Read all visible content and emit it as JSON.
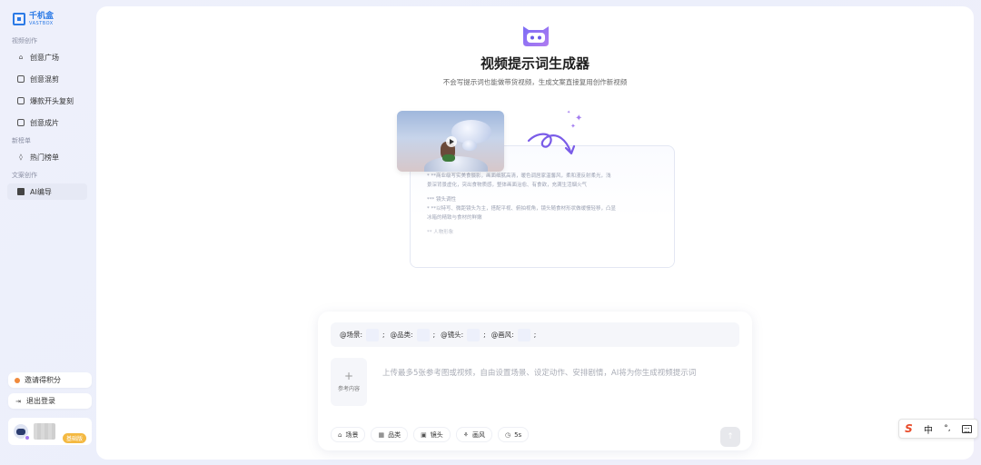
{
  "brand": {
    "name_cn": "千机盒",
    "name_en": "VASTBOX",
    "color": "#2b7ae6"
  },
  "sidebar": {
    "sections": [
      {
        "title": "视频创作",
        "items": [
          {
            "label": "创意广场",
            "icon": "home-icon"
          },
          {
            "label": "创意混剪",
            "icon": "film-icon"
          },
          {
            "label": "爆款开头复刻",
            "icon": "copy-icon"
          },
          {
            "label": "创意成片",
            "icon": "clip-icon"
          }
        ]
      },
      {
        "title": "新榜单",
        "items": [
          {
            "label": "热门榜单",
            "icon": "fire-icon"
          }
        ]
      },
      {
        "title": "文案创作",
        "items": [
          {
            "label": "AI编导",
            "icon": "ai-director-icon",
            "active": true
          }
        ]
      }
    ],
    "invite_label": "邀请得积分",
    "logout_label": "退出登录",
    "user_badge": "基础版"
  },
  "main": {
    "title": "视频提示词生成器",
    "subtitle": "不会写提示词也能做带货视频，生成文案直接复用创作新视频",
    "illustration_lines": [
      "*  **商业级写实美食摄影，画面细腻高清，暖色调居家温馨风，柔和漫反射柔光，浅",
      "景深背景虚化，突出食物质感，整体画面治愈、有食欲，充满生活烟火气",
      "*** 镜头调性",
      "*  **以特写、微距镜头为主，搭配平视、俯拍视角，镜头随食材形状做缓慢轻移，凸显",
      "冰箱的精致与食材的鲜嫩",
      "** 人物形象"
    ]
  },
  "composer": {
    "tags": [
      "@场景:",
      "@品类:",
      "@镜头:",
      "@画风:"
    ],
    "tag_separator": ";",
    "upload_label": "参考内容",
    "upload_plus": "+",
    "placeholder": "上传最多5张参考图或视频，自由设置场景、设定动作、安排剧情，AI将为你生成视频提示词",
    "tools": [
      {
        "label": "场景",
        "icon": "scene-icon"
      },
      {
        "label": "品类",
        "icon": "category-icon"
      },
      {
        "label": "镜头",
        "icon": "camera-icon"
      },
      {
        "label": "画风",
        "icon": "style-icon"
      },
      {
        "label": "5s",
        "icon": "duration-icon"
      }
    ],
    "send_glyph": "↑"
  },
  "ime": {
    "logo": "S",
    "mode": "中",
    "punct": "°,"
  }
}
